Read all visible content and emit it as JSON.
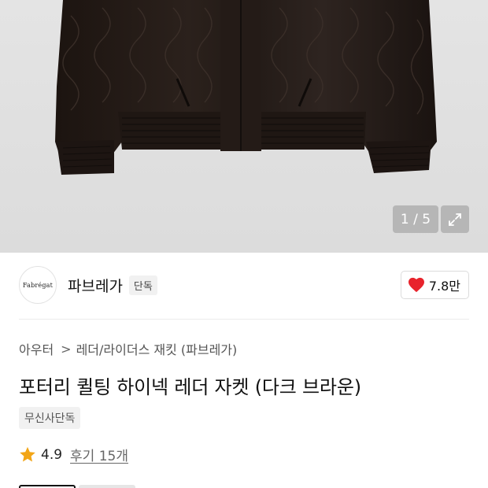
{
  "gallery": {
    "counter": "1 / 5",
    "image_icon": "jacket-product-image",
    "expand_icon": "expand-icon"
  },
  "brand": {
    "logo_text": "Fabrégat",
    "name": "파브레가",
    "badge": "단독",
    "likes": "7.8만",
    "heart_color": "#e8232c"
  },
  "breadcrumb": {
    "category": "아우터",
    "separator": ">",
    "subcategory": "레더/라이더스 재킷 (파브레가)"
  },
  "product": {
    "title": "포터리 퀼팅 하이넥 레더 자켓 (다크 브라운)",
    "tag": "무신사단독"
  },
  "rating": {
    "star_color": "#f2a516",
    "score": "4.9",
    "reviews": "후기 15개"
  }
}
